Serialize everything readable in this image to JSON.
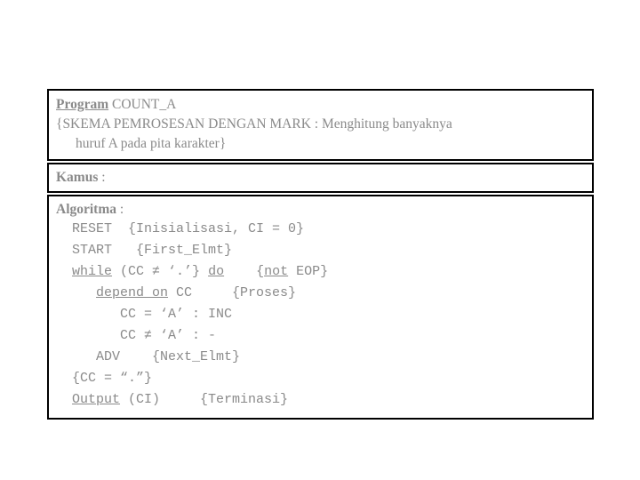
{
  "document": {
    "type": "pseudocode-slide",
    "text_color": "#8a8a8a",
    "border_color": "#000000",
    "background_color": "#ffffff",
    "header_block": {
      "keyword": "Program",
      "program_name": " COUNT_A",
      "comment_line_1": "{SKEMA PEMROSESAN DENGAN MARK : Menghitung banyaknya",
      "comment_line_2": "huruf A pada pita karakter}"
    },
    "kamus_block": {
      "label": "Kamus",
      "colon": " :",
      "body": ""
    },
    "algoritma_block": {
      "label": "Algoritma",
      "colon": " :",
      "lines": [
        {
          "id": "reset",
          "segments": [
            {
              "text": "  RESET  {Inisialisasi, CI = 0}",
              "underline": false
            }
          ]
        },
        {
          "id": "start",
          "segments": [
            {
              "text": "  START   {First_Elmt}",
              "underline": false
            }
          ]
        },
        {
          "id": "while",
          "segments": [
            {
              "text": "  ",
              "underline": false
            },
            {
              "text": "while",
              "underline": true
            },
            {
              "text": " (CC ≠ ‘.’} ",
              "underline": false
            },
            {
              "text": "do",
              "underline": true
            },
            {
              "text": "    {",
              "underline": false
            },
            {
              "text": "not",
              "underline": true
            },
            {
              "text": " EOP}",
              "underline": false
            }
          ]
        },
        {
          "id": "depend-on",
          "segments": [
            {
              "text": "     ",
              "underline": false
            },
            {
              "text": "depend on",
              "underline": true
            },
            {
              "text": " CC     {Proses}",
              "underline": false
            }
          ]
        },
        {
          "id": "case-equal-a",
          "segments": [
            {
              "text": "        CC = ‘A’ : INC",
              "underline": false
            }
          ]
        },
        {
          "id": "case-not-equal-a",
          "segments": [
            {
              "text": "        CC ≠ ‘A’ : -",
              "underline": false
            }
          ]
        },
        {
          "id": "adv",
          "segments": [
            {
              "text": "     ADV    {Next_Elmt}",
              "underline": false
            }
          ]
        },
        {
          "id": "assert-mark",
          "segments": [
            {
              "text": "  {CC = “.”}",
              "underline": false
            }
          ]
        },
        {
          "id": "output",
          "segments": [
            {
              "text": "  ",
              "underline": false
            },
            {
              "text": "Output",
              "underline": true
            },
            {
              "text": " (CI)     {Terminasi}",
              "underline": false
            }
          ]
        }
      ]
    }
  }
}
